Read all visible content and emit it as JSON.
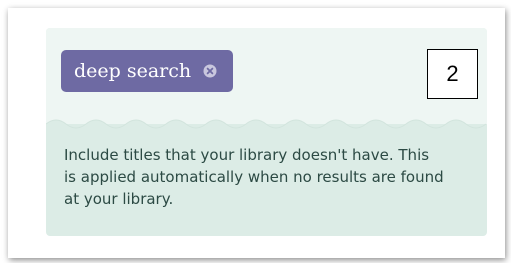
{
  "chip": {
    "label": "deep search",
    "remove_icon": "close-circle-icon"
  },
  "description": {
    "line1": "Include titles that your library doesn't have. This",
    "line2": "is applied automatically when no results are found",
    "line3": "at your library."
  },
  "annotation": {
    "step_number": "2"
  },
  "colors": {
    "chip_background": "#6e6aa3",
    "panel_top": "#eef6f3",
    "panel_bottom": "#dcece6",
    "text": "#2c4a44"
  }
}
